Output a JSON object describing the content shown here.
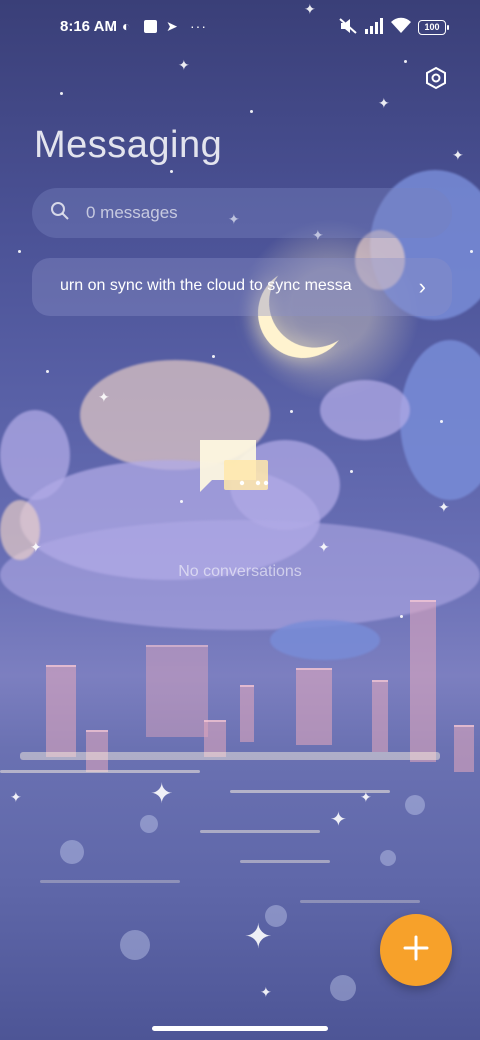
{
  "status_bar": {
    "time": "8:16 AM",
    "icons": [
      "notification-c-icon",
      "square-app-icon",
      "play-icon",
      "more-dots-icon",
      "mute-icon",
      "signal-icon",
      "wifi-icon"
    ],
    "more_dots": "···",
    "battery": "100"
  },
  "header": {
    "title": "Messaging",
    "settings_icon": "settings-hexagon-icon"
  },
  "search": {
    "placeholder": "0 messages",
    "icon": "search-icon"
  },
  "sync_banner": {
    "text": "urn on sync with the cloud to sync messa",
    "chevron": "›"
  },
  "empty_state": {
    "icon": "chat-bubbles-icon",
    "text": "No conversations"
  },
  "fab": {
    "icon": "plus-icon",
    "color": "#f7a12a"
  },
  "colors": {
    "accent": "#f7a12a",
    "background_top": "#3a3f78",
    "background_mid": "#7c7fc0"
  }
}
